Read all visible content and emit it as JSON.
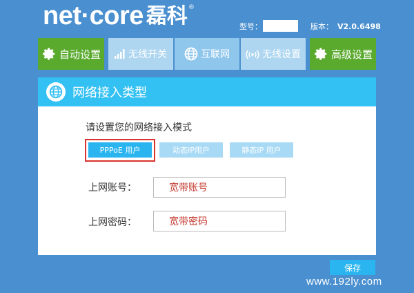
{
  "header": {
    "brand_latin": "net·core",
    "brand_cjk": "磊科",
    "brand_reg": "®",
    "model_label": "型号：",
    "version_label": "版本：",
    "version_value": "V2.0.6498"
  },
  "nav": {
    "tabs": [
      {
        "label": "自动设置",
        "icon": "gear-icon"
      },
      {
        "label": "无线开关",
        "icon": "signal-bars-icon"
      },
      {
        "label": "互联网",
        "icon": "globe-icon"
      },
      {
        "label": "无线设置",
        "icon": "wifi-icon"
      },
      {
        "label": "高级设置",
        "icon": "gear-icon"
      }
    ]
  },
  "panel": {
    "title": "网络接入类型",
    "prompt": "请设置您的网络接入模式",
    "modes": [
      {
        "label": "PPPoE 用户",
        "active": true
      },
      {
        "label": "动态IP用户",
        "active": false
      },
      {
        "label": "静态IP 用户",
        "active": false
      }
    ],
    "account_label": "上网账号：",
    "account_value": "宽带账号",
    "password_label": "上网密码：",
    "password_value": "宽带密码"
  },
  "footer": {
    "save_label": "保存",
    "watermark": "www.192ly.com"
  },
  "colors": {
    "background": "#4a8fcf",
    "green_tab": "#5aaa2e",
    "light_tab": "#aed6f1",
    "accent": "#33c0f2",
    "highlight_border": "#d9322c",
    "input_text": "#c43a2e"
  }
}
